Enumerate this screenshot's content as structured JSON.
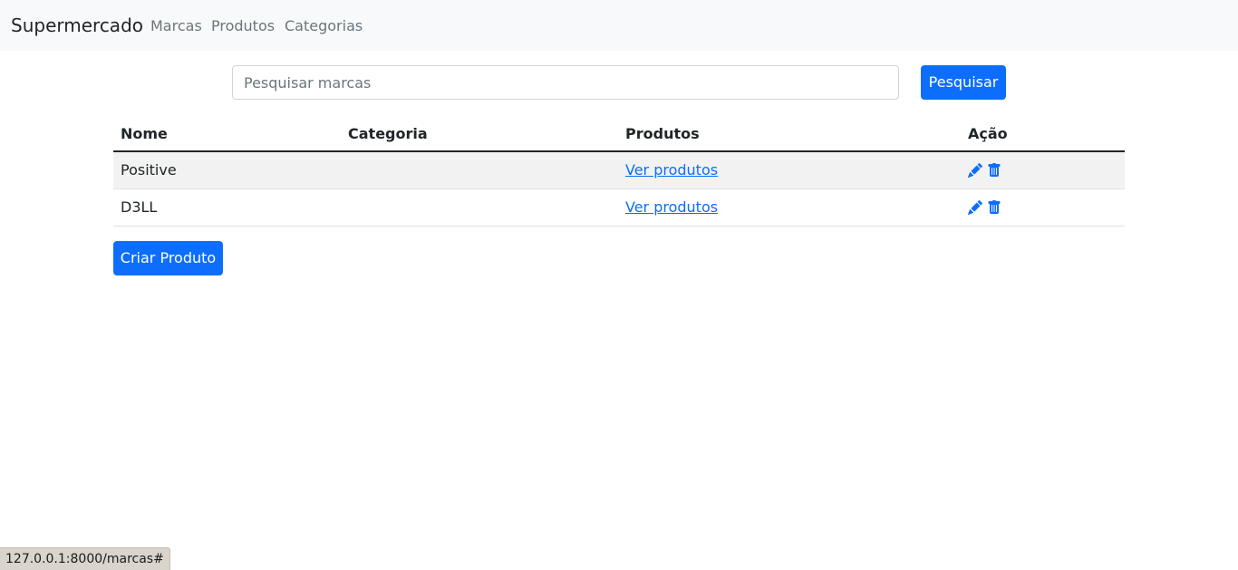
{
  "navbar": {
    "brand": "Supermercado",
    "links": [
      "Marcas",
      "Produtos",
      "Categorias"
    ]
  },
  "search": {
    "placeholder": "Pesquisar marcas",
    "value": "",
    "button_label": "Pesquisar"
  },
  "table": {
    "headers": [
      "Nome",
      "Categoria",
      "Produtos",
      "Ação"
    ],
    "rows": [
      {
        "nome": "Positive",
        "categoria": "",
        "produtos_link": "Ver produtos",
        "actions": [
          "pencil-icon",
          "trash-icon"
        ]
      },
      {
        "nome": "D3LL",
        "categoria": "",
        "produtos_link": "Ver produtos",
        "actions": [
          "pencil-icon",
          "trash-icon"
        ]
      }
    ]
  },
  "create_button_label": "Criar Produto",
  "status_bar": {
    "url": "127.0.0.1:8000/marcas#"
  },
  "colors": {
    "primary": "#0d6efd",
    "navbar_bg": "#f8f9fa",
    "status_bar_bg": "#d9d4cc"
  }
}
